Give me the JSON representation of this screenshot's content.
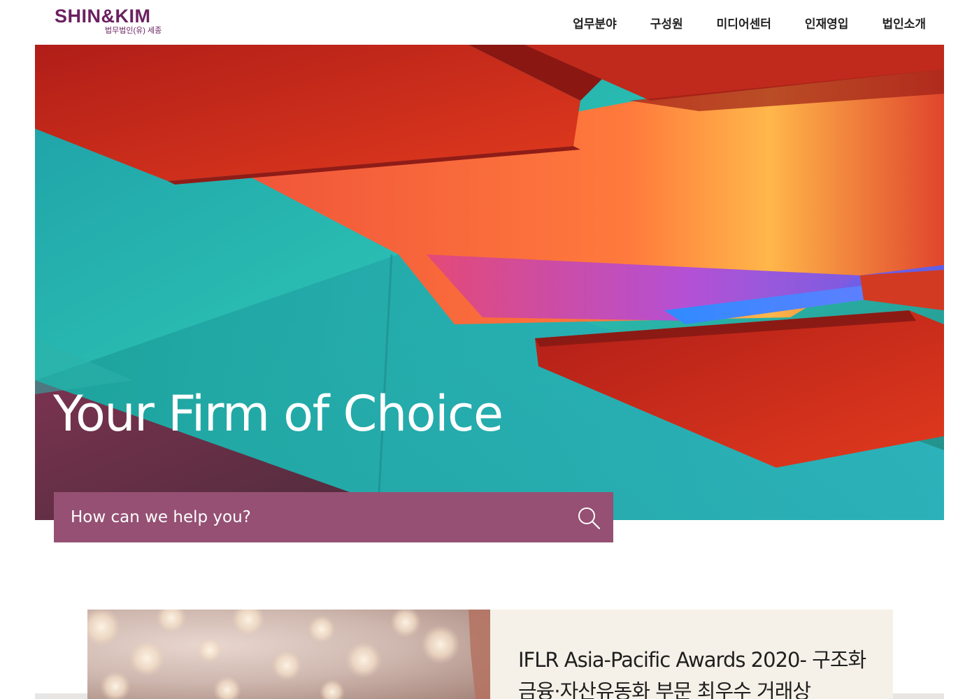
{
  "header": {
    "logo": {
      "mark": "SHIN&KIM",
      "subtitle": "법무법인(유) 세종",
      "color": "#6b2160"
    },
    "nav": [
      {
        "label": "업무분야"
      },
      {
        "label": "구성원"
      },
      {
        "label": "미디어센터"
      },
      {
        "label": "인재영입"
      },
      {
        "label": "법인소개"
      }
    ]
  },
  "hero": {
    "title": "Your Firm of Choice"
  },
  "search": {
    "placeholder": "How can we help you?",
    "icon": "search-icon",
    "background": "#955073"
  },
  "news": {
    "title": "IFLR Asia-Pacific Awards 2020- 구조화금융·자산유동화 부문 최우수 거래상"
  }
}
